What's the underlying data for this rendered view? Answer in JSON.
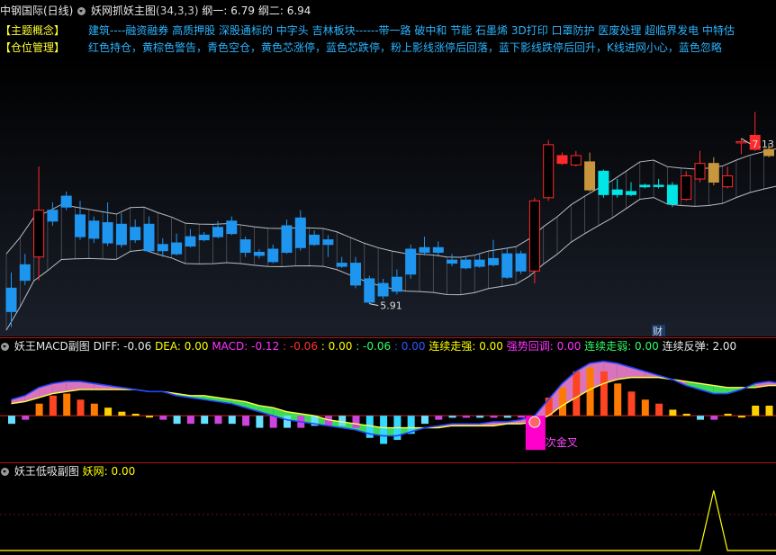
{
  "main_header": {
    "stock": "中钢国际(日线)",
    "indicator": "妖网抓妖主图",
    "params": "(34,3,3)",
    "line1_label": "纲一:",
    "line1_value": "6.79",
    "line2_label": "纲二:",
    "line2_value": "6.94"
  },
  "concept": {
    "tag": "【主题概念】",
    "text": "建筑----融资融券 高质押股 深股通标的 中字头 吉林板块------带一路 破中和 节能 石墨烯 3D打印 口罩防护 医废处理 超临界发电 中特估"
  },
  "position": {
    "tag": "【仓位管理】",
    "text": "红色持仓，黄棕色警告，青色空仓，黄色芯涨停，蓝色芯跌停，粉上影线涨停后回落，蓝下影线跌停后回升，K线进网小心，蓝色忽略"
  },
  "macd_header": {
    "title": "妖王MACD副图",
    "diff_label": "DIFF:",
    "diff_value": "-0.06",
    "dea_label": "DEA:",
    "dea_value": "0.00",
    "macd_label": "MACD:",
    "macd_value": "-0.12",
    "v1": ": -0.06",
    "v2": ": 0.00",
    "v3": ": -0.06",
    "v4": ": 0.00",
    "s1_label": "连续走强:",
    "s1_value": "0.00",
    "s2_label": "强势回调:",
    "s2_value": "0.00",
    "s3_label": "连续走弱:",
    "s3_value": "0.00",
    "s4_label": "连续反弹:",
    "s4_value": "2.00"
  },
  "low_header": {
    "title": "妖王低吸副图",
    "label": "妖网:",
    "value": "0.00"
  },
  "colors": {
    "up_red": "#ff2a2a",
    "down_blue": "#1e96f0",
    "warn_tan": "#c8963c",
    "empty_cyan": "#00e6e6",
    "divider": "#b01818"
  },
  "chart_data": [
    {
      "type": "candlestick",
      "name": "main",
      "annotations": {
        "high_label": "7.13",
        "low_label": "5.91",
        "badge": "财",
        "high_index": 53,
        "low_index": 26
      },
      "price_range": [
        5.8,
        7.3
      ],
      "candles": [
        {
          "o": 6.0,
          "c": 5.85,
          "h": 6.1,
          "l": 5.75,
          "k": "blue"
        },
        {
          "o": 6.05,
          "c": 6.15,
          "h": 6.22,
          "l": 6.02,
          "k": "blue"
        },
        {
          "o": 6.2,
          "c": 6.5,
          "h": 6.78,
          "l": 6.05,
          "k": "red"
        },
        {
          "o": 6.5,
          "c": 6.43,
          "h": 6.55,
          "l": 6.4,
          "k": "blue"
        },
        {
          "o": 6.52,
          "c": 6.59,
          "h": 6.62,
          "l": 6.5,
          "k": "blue"
        },
        {
          "o": 6.47,
          "c": 6.33,
          "h": 6.56,
          "l": 6.31,
          "k": "blue"
        },
        {
          "o": 6.43,
          "c": 6.32,
          "h": 6.46,
          "l": 6.29,
          "k": "blue"
        },
        {
          "o": 6.42,
          "c": 6.29,
          "h": 6.55,
          "l": 6.27,
          "k": "blue"
        },
        {
          "o": 6.41,
          "c": 6.28,
          "h": 6.48,
          "l": 6.26,
          "k": "blue"
        },
        {
          "o": 6.39,
          "c": 6.31,
          "h": 6.44,
          "l": 6.29,
          "k": "blue"
        },
        {
          "o": 6.41,
          "c": 6.24,
          "h": 6.46,
          "l": 6.23,
          "k": "blue"
        },
        {
          "o": 6.28,
          "c": 6.24,
          "h": 6.32,
          "l": 6.2,
          "k": "blue"
        },
        {
          "o": 6.29,
          "c": 6.22,
          "h": 6.35,
          "l": 6.21,
          "k": "blue"
        },
        {
          "o": 6.33,
          "c": 6.27,
          "h": 6.38,
          "l": 6.26,
          "k": "blue"
        },
        {
          "o": 6.34,
          "c": 6.31,
          "h": 6.36,
          "l": 6.3,
          "k": "blue"
        },
        {
          "o": 6.39,
          "c": 6.33,
          "h": 6.43,
          "l": 6.32,
          "k": "blue"
        },
        {
          "o": 6.43,
          "c": 6.35,
          "h": 6.46,
          "l": 6.34,
          "k": "blue"
        },
        {
          "o": 6.31,
          "c": 6.23,
          "h": 6.33,
          "l": 6.2,
          "k": "blue"
        },
        {
          "o": 6.23,
          "c": 6.21,
          "h": 6.25,
          "l": 6.19,
          "k": "blue"
        },
        {
          "o": 6.25,
          "c": 6.17,
          "h": 6.28,
          "l": 6.16,
          "k": "blue"
        },
        {
          "o": 6.4,
          "c": 6.23,
          "h": 6.44,
          "l": 6.22,
          "k": "blue"
        },
        {
          "o": 6.45,
          "c": 6.26,
          "h": 6.5,
          "l": 6.24,
          "k": "blue"
        },
        {
          "o": 6.34,
          "c": 6.28,
          "h": 6.37,
          "l": 6.27,
          "k": "blue"
        },
        {
          "o": 6.31,
          "c": 6.28,
          "h": 6.34,
          "l": 6.2,
          "k": "blue"
        },
        {
          "o": 6.16,
          "c": 6.14,
          "h": 6.2,
          "l": 6.13,
          "k": "blue"
        },
        {
          "o": 6.16,
          "c": 6.02,
          "h": 6.2,
          "l": 6.0,
          "k": "blue"
        },
        {
          "o": 6.06,
          "c": 5.91,
          "h": 6.08,
          "l": 5.9,
          "k": "blue"
        },
        {
          "o": 6.03,
          "c": 5.95,
          "h": 6.06,
          "l": 5.93,
          "k": "blue"
        },
        {
          "o": 6.07,
          "c": 5.98,
          "h": 6.12,
          "l": 5.96,
          "k": "blue"
        },
        {
          "o": 6.25,
          "c": 6.09,
          "h": 6.28,
          "l": 6.06,
          "k": "blue"
        },
        {
          "o": 6.26,
          "c": 6.23,
          "h": 6.33,
          "l": 6.21,
          "k": "blue"
        },
        {
          "o": 6.26,
          "c": 6.23,
          "h": 6.3,
          "l": 6.21,
          "k": "blue"
        },
        {
          "o": 6.18,
          "c": 6.16,
          "h": 6.22,
          "l": 6.14,
          "k": "blue"
        },
        {
          "o": 6.18,
          "c": 6.13,
          "h": 6.2,
          "l": 6.12,
          "k": "blue"
        },
        {
          "o": 6.18,
          "c": 6.14,
          "h": 6.22,
          "l": 6.13,
          "k": "blue"
        },
        {
          "o": 6.19,
          "c": 6.15,
          "h": 6.31,
          "l": 6.14,
          "k": "blue"
        },
        {
          "o": 6.22,
          "c": 6.07,
          "h": 6.26,
          "l": 6.06,
          "k": "blue"
        },
        {
          "o": 6.22,
          "c": 6.11,
          "h": 6.24,
          "l": 6.09,
          "k": "blue"
        },
        {
          "o": 6.11,
          "c": 6.56,
          "h": 6.58,
          "l": 6.03,
          "k": "red"
        },
        {
          "o": 6.58,
          "c": 6.92,
          "h": 6.95,
          "l": 6.56,
          "k": "red"
        },
        {
          "o": 6.85,
          "c": 6.8,
          "h": 6.87,
          "l": 6.79,
          "k": "red_fill"
        },
        {
          "o": 6.79,
          "c": 6.85,
          "h": 6.88,
          "l": 6.78,
          "k": "red"
        },
        {
          "o": 6.81,
          "c": 6.63,
          "h": 6.87,
          "l": 6.62,
          "k": "tan"
        },
        {
          "o": 6.75,
          "c": 6.6,
          "h": 6.76,
          "l": 6.58,
          "k": "cyan"
        },
        {
          "o": 6.63,
          "c": 6.6,
          "h": 6.7,
          "l": 6.58,
          "k": "cyan"
        },
        {
          "o": 6.62,
          "c": 6.6,
          "h": 6.68,
          "l": 6.59,
          "k": "cyan"
        },
        {
          "o": 6.66,
          "c": 6.65,
          "h": 6.67,
          "l": 6.64,
          "k": "cyan"
        },
        {
          "o": 6.66,
          "c": 6.66,
          "h": 6.7,
          "l": 6.64,
          "k": "cyan"
        },
        {
          "o": 6.66,
          "c": 6.54,
          "h": 6.68,
          "l": 6.52,
          "k": "cyan"
        },
        {
          "o": 6.57,
          "c": 6.72,
          "h": 6.75,
          "l": 6.56,
          "k": "red"
        },
        {
          "o": 6.7,
          "c": 6.8,
          "h": 6.88,
          "l": 6.68,
          "k": "red"
        },
        {
          "o": 6.8,
          "c": 6.68,
          "h": 6.84,
          "l": 6.66,
          "k": "tan"
        },
        {
          "o": 6.65,
          "c": 6.72,
          "h": 6.78,
          "l": 6.64,
          "k": "red"
        },
        {
          "o": 6.94,
          "c": 6.94,
          "h": 6.96,
          "l": 6.86,
          "k": "red"
        },
        {
          "o": 6.98,
          "c": 6.89,
          "h": 7.13,
          "l": 6.88,
          "k": "red_fill"
        },
        {
          "o": 6.89,
          "c": 6.85,
          "h": 6.93,
          "l": 6.84,
          "k": "tan"
        },
        {
          "o": 6.86,
          "c": 6.84,
          "h": 6.88,
          "l": 6.83,
          "k": "tan"
        }
      ]
    },
    {
      "type": "macd",
      "name": "macd",
      "histogram": [
        -0.04,
        -0.02,
        0.06,
        0.1,
        0.11,
        0.08,
        0.06,
        0.04,
        0.02,
        0.01,
        0.0,
        -0.02,
        -0.04,
        -0.04,
        -0.04,
        -0.04,
        -0.04,
        -0.05,
        -0.06,
        -0.06,
        -0.06,
        -0.06,
        -0.05,
        -0.05,
        -0.05,
        -0.06,
        -0.11,
        -0.14,
        -0.12,
        -0.09,
        -0.04,
        -0.02,
        -0.01,
        -0.01,
        -0.01,
        -0.01,
        -0.01,
        -0.01,
        -0.14,
        0.09,
        0.14,
        0.22,
        0.24,
        0.22,
        0.16,
        0.12,
        0.08,
        0.06,
        0.03,
        0.01,
        -0.02,
        -0.02,
        0.01,
        0.0,
        0.05,
        0.05,
        0.04
      ],
      "diff": [
        0.08,
        0.1,
        0.14,
        0.16,
        0.17,
        0.17,
        0.16,
        0.15,
        0.14,
        0.13,
        0.12,
        0.12,
        0.1,
        0.09,
        0.08,
        0.07,
        0.06,
        0.04,
        0.02,
        0.0,
        -0.02,
        -0.03,
        -0.04,
        -0.05,
        -0.06,
        -0.07,
        -0.09,
        -0.1,
        -0.1,
        -0.08,
        -0.06,
        -0.05,
        -0.04,
        -0.04,
        -0.04,
        -0.03,
        -0.03,
        -0.02,
        0.0,
        0.08,
        0.16,
        0.22,
        0.26,
        0.27,
        0.26,
        0.24,
        0.22,
        0.2,
        0.18,
        0.15,
        0.13,
        0.11,
        0.11,
        0.13,
        0.16,
        0.17,
        0.16
      ],
      "dea": [
        0.06,
        0.07,
        0.09,
        0.11,
        0.12,
        0.13,
        0.13,
        0.13,
        0.13,
        0.13,
        0.12,
        0.12,
        0.11,
        0.1,
        0.1,
        0.09,
        0.08,
        0.07,
        0.05,
        0.04,
        0.02,
        0.01,
        0.0,
        -0.02,
        -0.03,
        -0.04,
        -0.05,
        -0.06,
        -0.06,
        -0.06,
        -0.06,
        -0.06,
        -0.05,
        -0.05,
        -0.05,
        -0.05,
        -0.04,
        -0.04,
        -0.03,
        0.0,
        0.05,
        0.09,
        0.13,
        0.16,
        0.18,
        0.19,
        0.19,
        0.19,
        0.18,
        0.17,
        0.16,
        0.15,
        0.14,
        0.14,
        0.14,
        0.15,
        0.15
      ],
      "range": [
        -0.16,
        0.3
      ],
      "annotation": "次金叉",
      "annotation_index": 38
    },
    {
      "type": "line",
      "name": "low",
      "values": [
        0,
        0,
        0,
        0,
        0,
        0,
        0,
        0,
        0,
        0,
        0,
        0,
        0,
        0,
        0,
        0,
        0,
        0,
        0,
        0,
        0,
        0,
        0,
        0,
        0,
        0,
        0,
        0,
        0,
        0,
        0,
        0,
        0,
        0,
        0,
        0,
        0,
        0,
        0,
        0,
        0,
        0,
        0,
        0,
        0,
        0,
        0,
        0,
        0,
        0,
        0,
        0,
        0,
        0,
        0,
        0,
        0
      ],
      "spike_index": 51,
      "spike_value": 1,
      "range": [
        0,
        1.2
      ]
    }
  ]
}
